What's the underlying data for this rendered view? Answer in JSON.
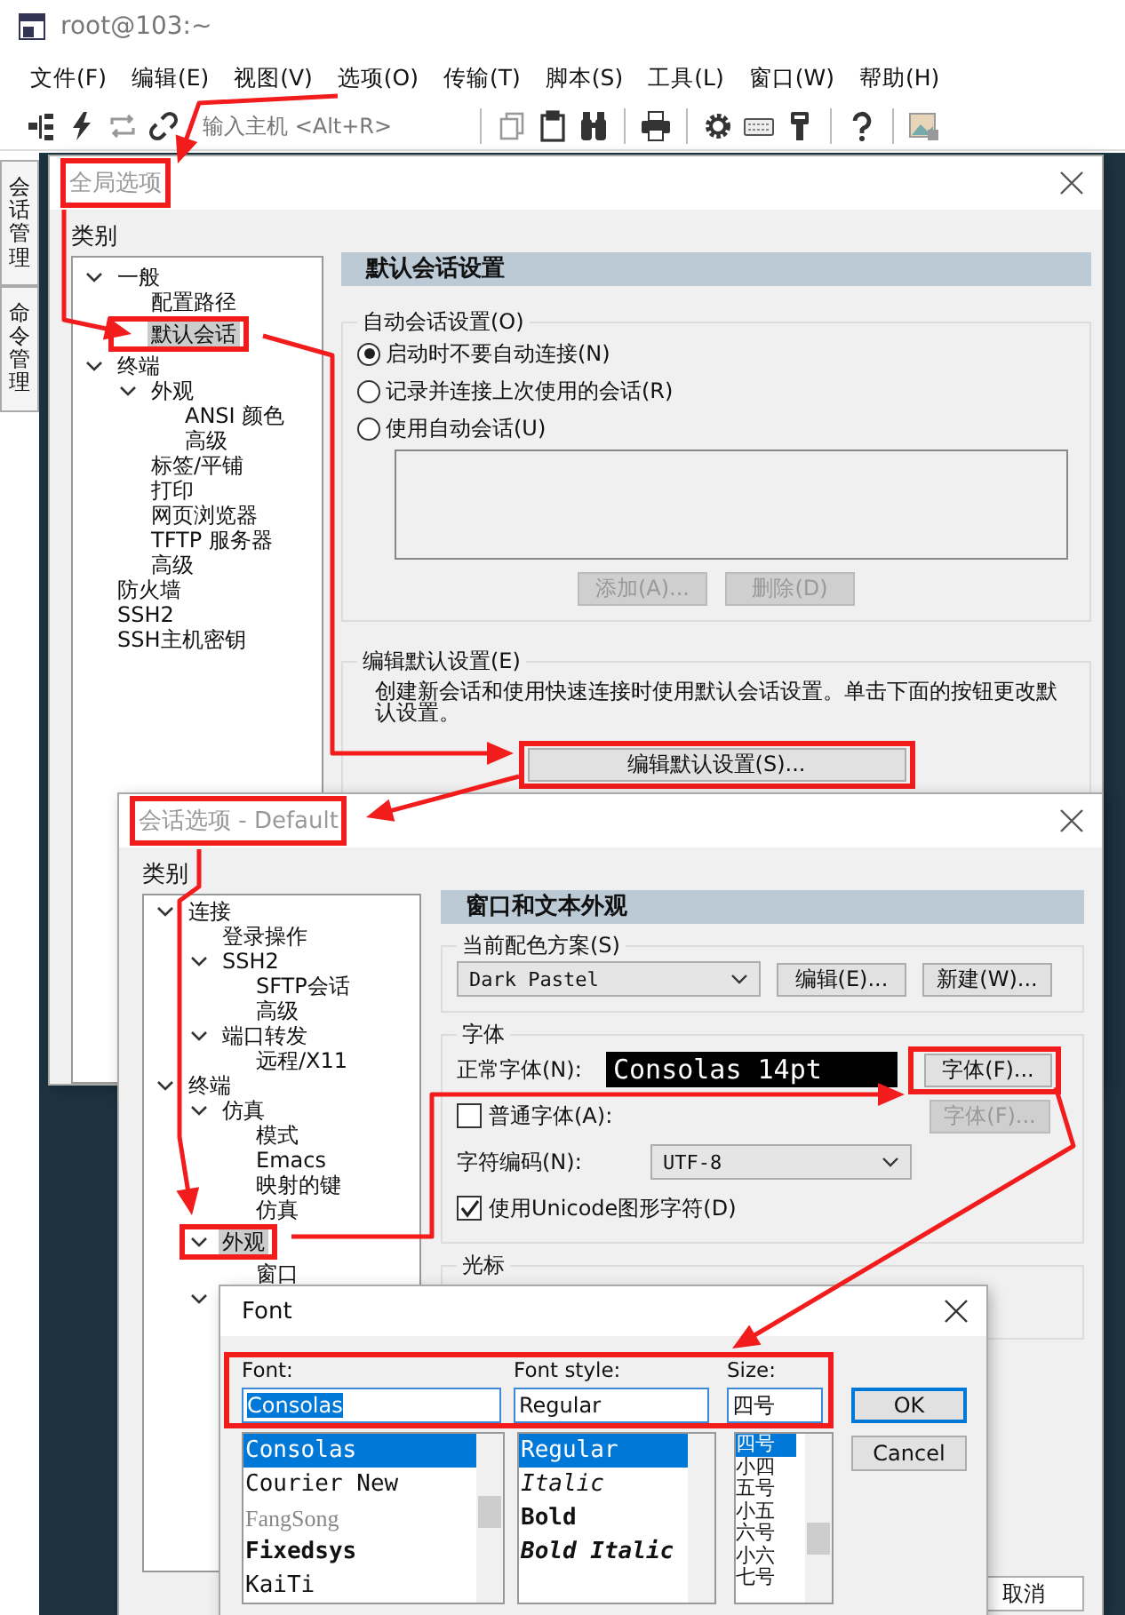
{
  "app": {
    "title": "root@103:~",
    "menu": [
      "文件(F)",
      "编辑(E)",
      "视图(V)",
      "选项(O)",
      "传输(T)",
      "脚本(S)",
      "工具(L)",
      "窗口(W)",
      "帮助(H)"
    ],
    "host_hint": "输入主机 <Alt+R>",
    "side_tabs": [
      "会话管理",
      "命令管理"
    ]
  },
  "global_options": {
    "title": "全局选项",
    "title_highlighted": true,
    "category_label": "类别",
    "tree": [
      {
        "label": "一般",
        "expanded": true,
        "selected": false,
        "highlighted": false,
        "children": [
          {
            "label": "配置路径",
            "selected": false,
            "highlighted": false
          },
          {
            "label": "默认会话",
            "selected": true,
            "highlighted": true
          }
        ]
      },
      {
        "label": "终端",
        "expanded": true,
        "selected": false,
        "highlighted": false,
        "children": [
          {
            "label": "外观",
            "expanded": true,
            "selected": false,
            "highlighted": false,
            "children": [
              {
                "label": "ANSI 颜色",
                "selected": false,
                "highlighted": false
              },
              {
                "label": "高级",
                "selected": false,
                "highlighted": false
              }
            ]
          },
          {
            "label": "标签/平铺",
            "selected": false,
            "highlighted": false
          },
          {
            "label": "打印",
            "selected": false,
            "highlighted": false
          },
          {
            "label": "网页浏览器",
            "selected": false,
            "highlighted": false
          },
          {
            "label": "TFTP 服务器",
            "selected": false,
            "highlighted": false
          },
          {
            "label": "高级",
            "selected": false,
            "highlighted": false
          }
        ]
      },
      {
        "label": "防火墙",
        "selected": false,
        "highlighted": false
      },
      {
        "label": "SSH2",
        "selected": false,
        "highlighted": false
      },
      {
        "label": "SSH主机密钥",
        "selected": false,
        "highlighted": false
      }
    ],
    "panel_title": "默认会话设置",
    "auto_group": "自动会话设置(O)",
    "radios": [
      {
        "label": "启动时不要自动连接(N)",
        "selected": true
      },
      {
        "label": "记录并连接上次使用的会话(R)",
        "selected": false
      },
      {
        "label": "使用自动会话(U)",
        "selected": false
      }
    ],
    "list_buttons": [
      {
        "label": "添加(A)...",
        "disabled": true
      },
      {
        "label": "删除(D)",
        "disabled": true
      }
    ],
    "edit_group": "编辑默认设置(E)",
    "edit_text": "创建新会话和使用快速连接时使用默认会话设置。单击下面的按钮更改默认设置。",
    "edit_button": {
      "label": "编辑默认设置(S)...",
      "highlighted": true
    }
  },
  "session_options": {
    "title": "会话选项 - Default",
    "title_highlighted": true,
    "category_label": "类别",
    "tree": [
      {
        "label": "连接",
        "expanded": true,
        "selected": false,
        "highlighted": false,
        "children": [
          {
            "label": "登录操作",
            "selected": false,
            "highlighted": false
          },
          {
            "label": "SSH2",
            "expanded": true,
            "selected": false,
            "highlighted": false,
            "children": [
              {
                "label": "SFTP会话",
                "selected": false,
                "highlighted": false
              },
              {
                "label": "高级",
                "selected": false,
                "highlighted": false
              }
            ]
          },
          {
            "label": "端口转发",
            "expanded": true,
            "selected": false,
            "highlighted": false,
            "children": [
              {
                "label": "远程/X11",
                "selected": false,
                "highlighted": false
              }
            ]
          }
        ]
      },
      {
        "label": "终端",
        "expanded": true,
        "selected": false,
        "highlighted": false,
        "children": [
          {
            "label": "仿真",
            "expanded": true,
            "selected": false,
            "highlighted": false,
            "children": [
              {
                "label": "模式",
                "selected": false,
                "highlighted": false
              },
              {
                "label": "Emacs",
                "selected": false,
                "highlighted": false
              },
              {
                "label": "映射的键",
                "selected": false,
                "highlighted": false
              },
              {
                "label": "仿真",
                "selected": false,
                "highlighted": false
              }
            ]
          },
          {
            "label": "外观",
            "expanded": true,
            "selected": true,
            "highlighted": true,
            "children": [
              {
                "label": "窗口",
                "selected": false,
                "highlighted": false
              }
            ]
          },
          {
            "expanded": true
          }
        ]
      }
    ],
    "panel_title": "窗口和文本外观",
    "scheme_group": "当前配色方案(S)",
    "scheme_value": "Dark Pastel",
    "scheme_buttons": [
      "编辑(E)...",
      "新建(W)..."
    ],
    "font_group": "字体",
    "normal_font_label": "正常字体(N):",
    "font_preview": "Consolas 14pt",
    "font_button": {
      "label": "字体(F)...",
      "highlighted": true
    },
    "plain_font": {
      "label": "普通字体(A):",
      "checked": false
    },
    "plain_font_button": {
      "label": "字体(F)...",
      "disabled": true
    },
    "encoding_label": "字符编码(N):",
    "encoding_value": "UTF-8",
    "unicode": {
      "label": "使用Unicode图形字符(D)",
      "checked": true
    },
    "cursor_group": "光标",
    "cancel_button": "取消"
  },
  "font_dialog": {
    "title": "Font",
    "fields_highlighted": true,
    "font_label": "Font:",
    "font_value": "Consolas",
    "style_label": "Font style:",
    "style_value": "Regular",
    "size_label": "Size:",
    "size_value": "四号",
    "fonts": [
      {
        "label": "Consolas",
        "kind": "mono",
        "selected": true
      },
      {
        "label": "Courier New",
        "kind": "mono",
        "selected": false
      },
      {
        "label": "FangSong",
        "kind": "serif",
        "selected": false
      },
      {
        "label": "Fixedsys",
        "kind": "bold",
        "selected": false
      },
      {
        "label": "KaiTi",
        "kind": "mono",
        "selected": false
      }
    ],
    "styles": [
      {
        "label": "Regular",
        "kind": "regular",
        "selected": true
      },
      {
        "label": "Italic",
        "kind": "italic",
        "selected": false
      },
      {
        "label": "Bold",
        "kind": "bold",
        "selected": false
      },
      {
        "label": "Bold Italic",
        "kind": "bolditalic",
        "selected": false
      }
    ],
    "sizes": [
      {
        "label": "四号",
        "selected": true
      },
      {
        "label": "小四",
        "selected": false
      },
      {
        "label": "五号",
        "selected": false
      },
      {
        "label": "小五",
        "selected": false
      },
      {
        "label": "六号",
        "selected": false
      },
      {
        "label": "小六",
        "selected": false
      },
      {
        "label": "七号",
        "selected": false
      }
    ],
    "buttons": [
      "OK",
      "Cancel"
    ]
  }
}
